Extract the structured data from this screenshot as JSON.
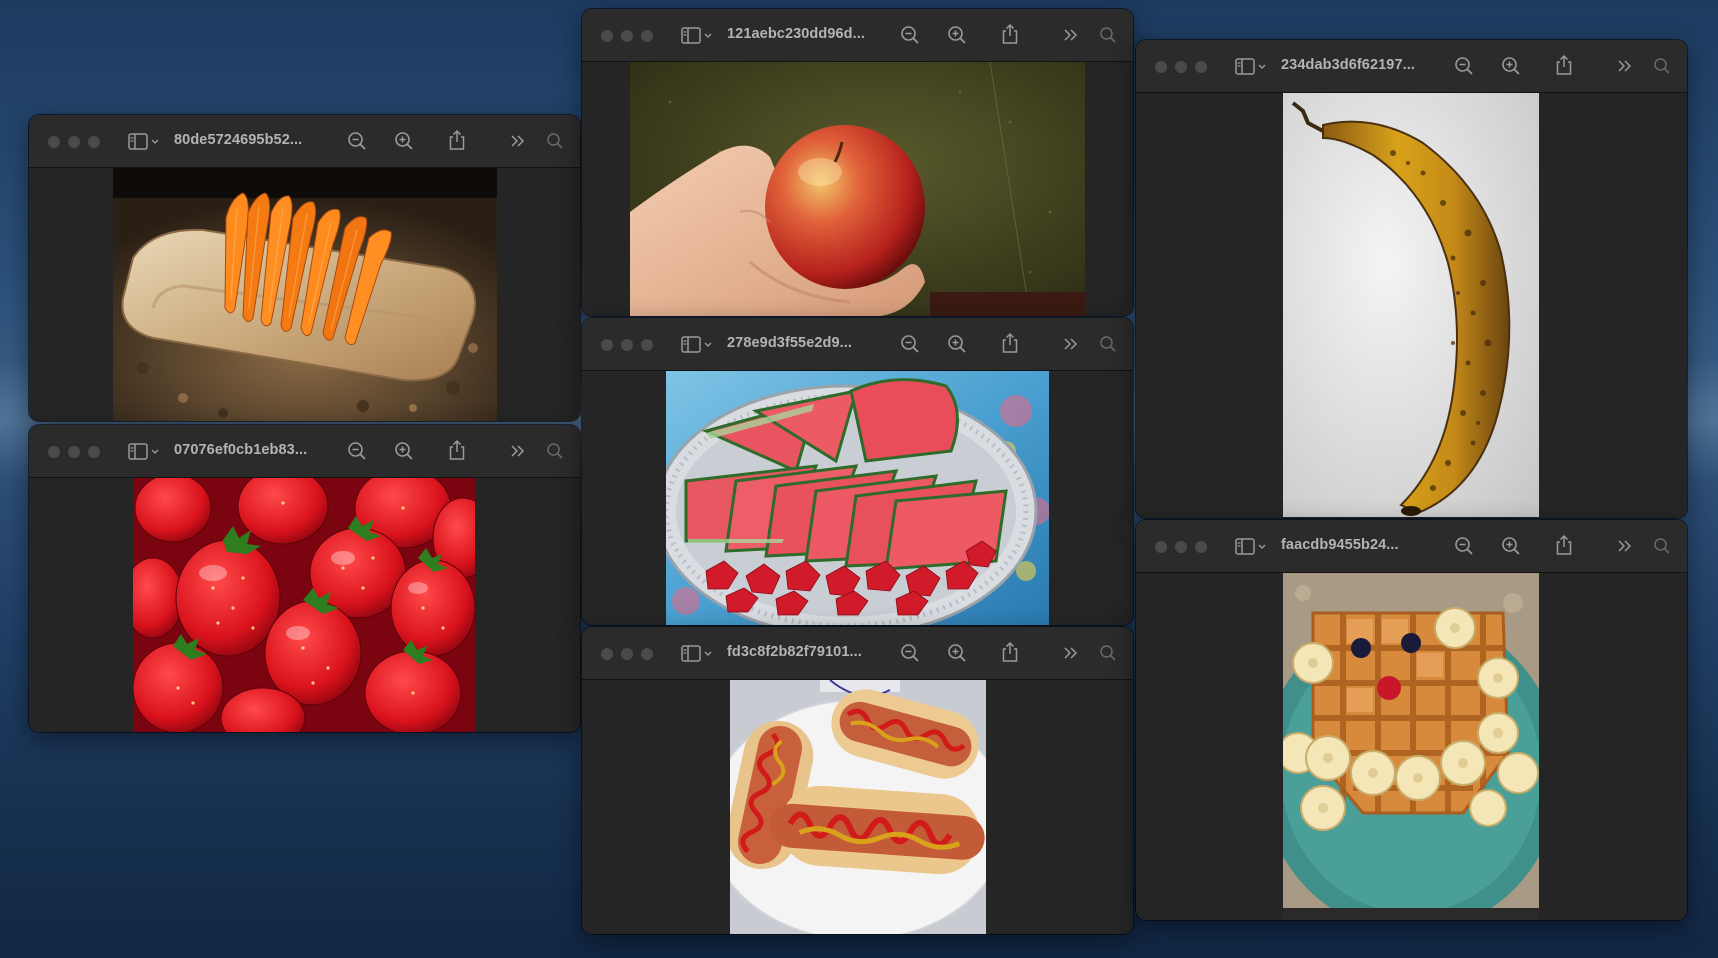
{
  "desktop": {
    "wallpaper": "ocean-night"
  },
  "windows": [
    {
      "id": "carrots",
      "title": "80de5724695b52...",
      "image": "carrots-on-cutting-board"
    },
    {
      "id": "strawberries",
      "title": "07076ef0cb1eb83...",
      "image": "strawberries"
    },
    {
      "id": "apple",
      "title": "121aebc230dd96d...",
      "image": "apple-in-hand"
    },
    {
      "id": "watermelon",
      "title": "278e9d3f55e2d9...",
      "image": "watermelon-and-strawberries"
    },
    {
      "id": "hotdogs",
      "title": "fd3c8f2b82f79101...",
      "image": "hot-dogs-with-ketchup-mustard"
    },
    {
      "id": "banana",
      "title": "234dab3d6f62197...",
      "image": "ripe-banana"
    },
    {
      "id": "waffle",
      "title": "faacdb9455b24...",
      "image": "waffle-face-with-bananas"
    }
  ],
  "toolbar_icons": [
    "sidebar-toggle-icon",
    "zoom-out-icon",
    "zoom-in-icon",
    "share-icon",
    "more-chevron-icon",
    "search-icon"
  ],
  "colors": {
    "window_bg": "#262626",
    "titlebar_bg": "#2b2b2b",
    "traffic_light_inactive": "#4a4a4a",
    "title_text": "#b4b4b4"
  }
}
